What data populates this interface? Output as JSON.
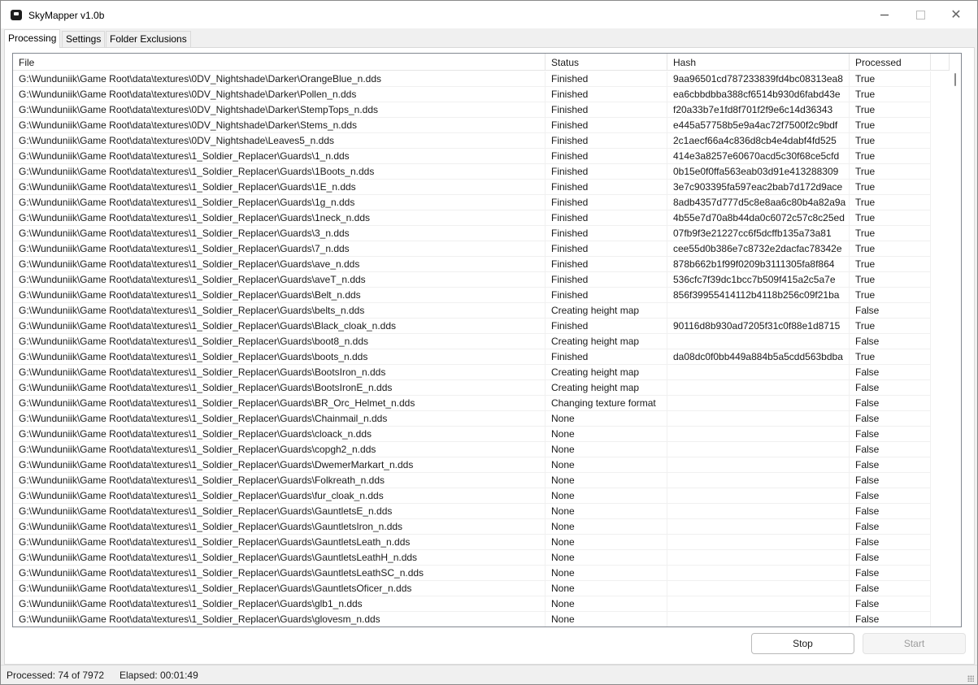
{
  "window": {
    "title": "SkyMapper v1.0b"
  },
  "tabs": [
    {
      "label": "Processing",
      "active": true
    },
    {
      "label": "Settings",
      "active": false
    },
    {
      "label": "Folder Exclusions",
      "active": false
    }
  ],
  "grid": {
    "columns": [
      "File",
      "Status",
      "Hash",
      "Processed"
    ],
    "rows": [
      [
        "G:\\Wunduniik\\Game Root\\data\\textures\\0DV_Nightshade\\Darker\\OrangeBlue_n.dds",
        "Finished",
        "9aa96501cd787233839fd4bc08313ea8",
        "True"
      ],
      [
        "G:\\Wunduniik\\Game Root\\data\\textures\\0DV_Nightshade\\Darker\\Pollen_n.dds",
        "Finished",
        "ea6cbbdbba388cf6514b930d6fabd43e",
        "True"
      ],
      [
        "G:\\Wunduniik\\Game Root\\data\\textures\\0DV_Nightshade\\Darker\\StempTops_n.dds",
        "Finished",
        "f20a33b7e1fd8f701f2f9e6c14d36343",
        "True"
      ],
      [
        "G:\\Wunduniik\\Game Root\\data\\textures\\0DV_Nightshade\\Darker\\Stems_n.dds",
        "Finished",
        "e445a57758b5e9a4ac72f7500f2c9bdf",
        "True"
      ],
      [
        "G:\\Wunduniik\\Game Root\\data\\textures\\0DV_Nightshade\\Leaves5_n.dds",
        "Finished",
        "2c1aecf66a4c836d8cb4e4dabf4fd525",
        "True"
      ],
      [
        "G:\\Wunduniik\\Game Root\\data\\textures\\1_Soldier_Replacer\\Guards\\1_n.dds",
        "Finished",
        "414e3a8257e60670acd5c30f68ce5cfd",
        "True"
      ],
      [
        "G:\\Wunduniik\\Game Root\\data\\textures\\1_Soldier_Replacer\\Guards\\1Boots_n.dds",
        "Finished",
        "0b15e0f0ffa563eab03d91e413288309",
        "True"
      ],
      [
        "G:\\Wunduniik\\Game Root\\data\\textures\\1_Soldier_Replacer\\Guards\\1E_n.dds",
        "Finished",
        "3e7c903395fa597eac2bab7d172d9ace",
        "True"
      ],
      [
        "G:\\Wunduniik\\Game Root\\data\\textures\\1_Soldier_Replacer\\Guards\\1g_n.dds",
        "Finished",
        "8adb4357d777d5c8e8aa6c80b4a82a9a",
        "True"
      ],
      [
        "G:\\Wunduniik\\Game Root\\data\\textures\\1_Soldier_Replacer\\Guards\\1neck_n.dds",
        "Finished",
        "4b55e7d70a8b44da0c6072c57c8c25ed",
        "True"
      ],
      [
        "G:\\Wunduniik\\Game Root\\data\\textures\\1_Soldier_Replacer\\Guards\\3_n.dds",
        "Finished",
        "07fb9f3e21227cc6f5dcffb135a73a81",
        "True"
      ],
      [
        "G:\\Wunduniik\\Game Root\\data\\textures\\1_Soldier_Replacer\\Guards\\7_n.dds",
        "Finished",
        "cee55d0b386e7c8732e2dacfac78342e",
        "True"
      ],
      [
        "G:\\Wunduniik\\Game Root\\data\\textures\\1_Soldier_Replacer\\Guards\\ave_n.dds",
        "Finished",
        "878b662b1f99f0209b3111305fa8f864",
        "True"
      ],
      [
        "G:\\Wunduniik\\Game Root\\data\\textures\\1_Soldier_Replacer\\Guards\\aveT_n.dds",
        "Finished",
        "536cfc7f39dc1bcc7b509f415a2c5a7e",
        "True"
      ],
      [
        "G:\\Wunduniik\\Game Root\\data\\textures\\1_Soldier_Replacer\\Guards\\Belt_n.dds",
        "Finished",
        "856f39955414112b4118b256c09f21ba",
        "True"
      ],
      [
        "G:\\Wunduniik\\Game Root\\data\\textures\\1_Soldier_Replacer\\Guards\\belts_n.dds",
        "Creating height map",
        "",
        "False"
      ],
      [
        "G:\\Wunduniik\\Game Root\\data\\textures\\1_Soldier_Replacer\\Guards\\Black_cloak_n.dds",
        "Finished",
        "90116d8b930ad7205f31c0f88e1d8715",
        "True"
      ],
      [
        "G:\\Wunduniik\\Game Root\\data\\textures\\1_Soldier_Replacer\\Guards\\boot8_n.dds",
        "Creating height map",
        "",
        "False"
      ],
      [
        "G:\\Wunduniik\\Game Root\\data\\textures\\1_Soldier_Replacer\\Guards\\boots_n.dds",
        "Finished",
        "da08dc0f0bb449a884b5a5cdd563bdba",
        "True"
      ],
      [
        "G:\\Wunduniik\\Game Root\\data\\textures\\1_Soldier_Replacer\\Guards\\BootsIron_n.dds",
        "Creating height map",
        "",
        "False"
      ],
      [
        "G:\\Wunduniik\\Game Root\\data\\textures\\1_Soldier_Replacer\\Guards\\BootsIronE_n.dds",
        "Creating height map",
        "",
        "False"
      ],
      [
        "G:\\Wunduniik\\Game Root\\data\\textures\\1_Soldier_Replacer\\Guards\\BR_Orc_Helmet_n.dds",
        "Changing texture format",
        "",
        "False"
      ],
      [
        "G:\\Wunduniik\\Game Root\\data\\textures\\1_Soldier_Replacer\\Guards\\Chainmail_n.dds",
        "None",
        "",
        "False"
      ],
      [
        "G:\\Wunduniik\\Game Root\\data\\textures\\1_Soldier_Replacer\\Guards\\cloack_n.dds",
        "None",
        "",
        "False"
      ],
      [
        "G:\\Wunduniik\\Game Root\\data\\textures\\1_Soldier_Replacer\\Guards\\copgh2_n.dds",
        "None",
        "",
        "False"
      ],
      [
        "G:\\Wunduniik\\Game Root\\data\\textures\\1_Soldier_Replacer\\Guards\\DwemerMarkart_n.dds",
        "None",
        "",
        "False"
      ],
      [
        "G:\\Wunduniik\\Game Root\\data\\textures\\1_Soldier_Replacer\\Guards\\Folkreath_n.dds",
        "None",
        "",
        "False"
      ],
      [
        "G:\\Wunduniik\\Game Root\\data\\textures\\1_Soldier_Replacer\\Guards\\fur_cloak_n.dds",
        "None",
        "",
        "False"
      ],
      [
        "G:\\Wunduniik\\Game Root\\data\\textures\\1_Soldier_Replacer\\Guards\\GauntletsE_n.dds",
        "None",
        "",
        "False"
      ],
      [
        "G:\\Wunduniik\\Game Root\\data\\textures\\1_Soldier_Replacer\\Guards\\GauntletsIron_n.dds",
        "None",
        "",
        "False"
      ],
      [
        "G:\\Wunduniik\\Game Root\\data\\textures\\1_Soldier_Replacer\\Guards\\GauntletsLeath_n.dds",
        "None",
        "",
        "False"
      ],
      [
        "G:\\Wunduniik\\Game Root\\data\\textures\\1_Soldier_Replacer\\Guards\\GauntletsLeathH_n.dds",
        "None",
        "",
        "False"
      ],
      [
        "G:\\Wunduniik\\Game Root\\data\\textures\\1_Soldier_Replacer\\Guards\\GauntletsLeathSC_n.dds",
        "None",
        "",
        "False"
      ],
      [
        "G:\\Wunduniik\\Game Root\\data\\textures\\1_Soldier_Replacer\\Guards\\GauntletsOficer_n.dds",
        "None",
        "",
        "False"
      ],
      [
        "G:\\Wunduniik\\Game Root\\data\\textures\\1_Soldier_Replacer\\Guards\\glb1_n.dds",
        "None",
        "",
        "False"
      ],
      [
        "G:\\Wunduniik\\Game Root\\data\\textures\\1_Soldier_Replacer\\Guards\\glovesm_n.dds",
        "None",
        "",
        "False"
      ]
    ]
  },
  "buttons": {
    "stop": "Stop",
    "start": "Start"
  },
  "status_bar": {
    "processed": "Processed: 74 of 7972",
    "elapsed": "Elapsed: 00:01:49"
  },
  "icons": {
    "app": "app-icon",
    "minimize": "minimize-icon",
    "maximize": "maximize-icon",
    "close": "close-icon",
    "resize_grip": "resize-grip-icon"
  }
}
